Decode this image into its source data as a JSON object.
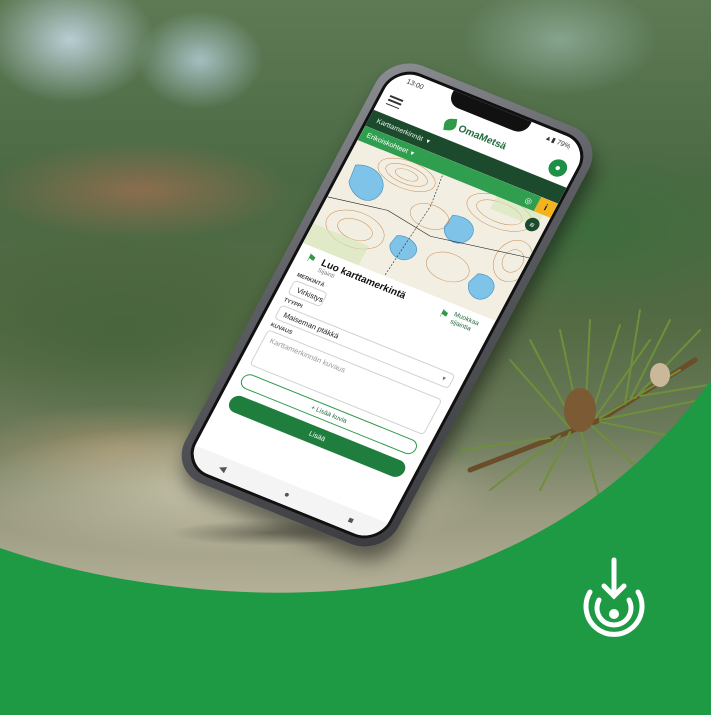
{
  "phone": {
    "status_time": "13:00",
    "status_icons": "▲▮ 79%",
    "app_name": "OmaMetsä",
    "avatar_glyph": "●",
    "breadcrumb": "Karttamerkinnät",
    "breadcrumb_caret": "▾",
    "map_select": "Erikoiskohteet",
    "map_select_caret": "▾",
    "map_eye": "◎",
    "map_info": "i",
    "map_layers": "≡",
    "form": {
      "title": "Luo karttamerkintä",
      "subtitle": "Sijainti",
      "side_action": "Muokkaa sijaintia",
      "fields": [
        {
          "label": "MERKINTÄ",
          "value": "Virkistys"
        },
        {
          "label": "TYYPPI",
          "value": "Maiseman ptäkkä"
        },
        {
          "label": "KUVAUS",
          "placeholder": "Karttamerkinnän kuvaus"
        }
      ],
      "add_photo": "+ Lisää kuvia",
      "submit": "Lisää"
    },
    "nav": {
      "back": "◀",
      "home": "●",
      "recent": "■"
    }
  },
  "colors": {
    "brand_green": "#1e9a45",
    "dark_green": "#1c4a2c",
    "accent_yellow": "#f2b31d"
  },
  "icons": [
    "menu-icon",
    "leaf-logo-icon",
    "user-avatar-icon",
    "eye-icon",
    "info-icon",
    "layers-icon",
    "map-pin-icon",
    "brand-mark-icon"
  ]
}
